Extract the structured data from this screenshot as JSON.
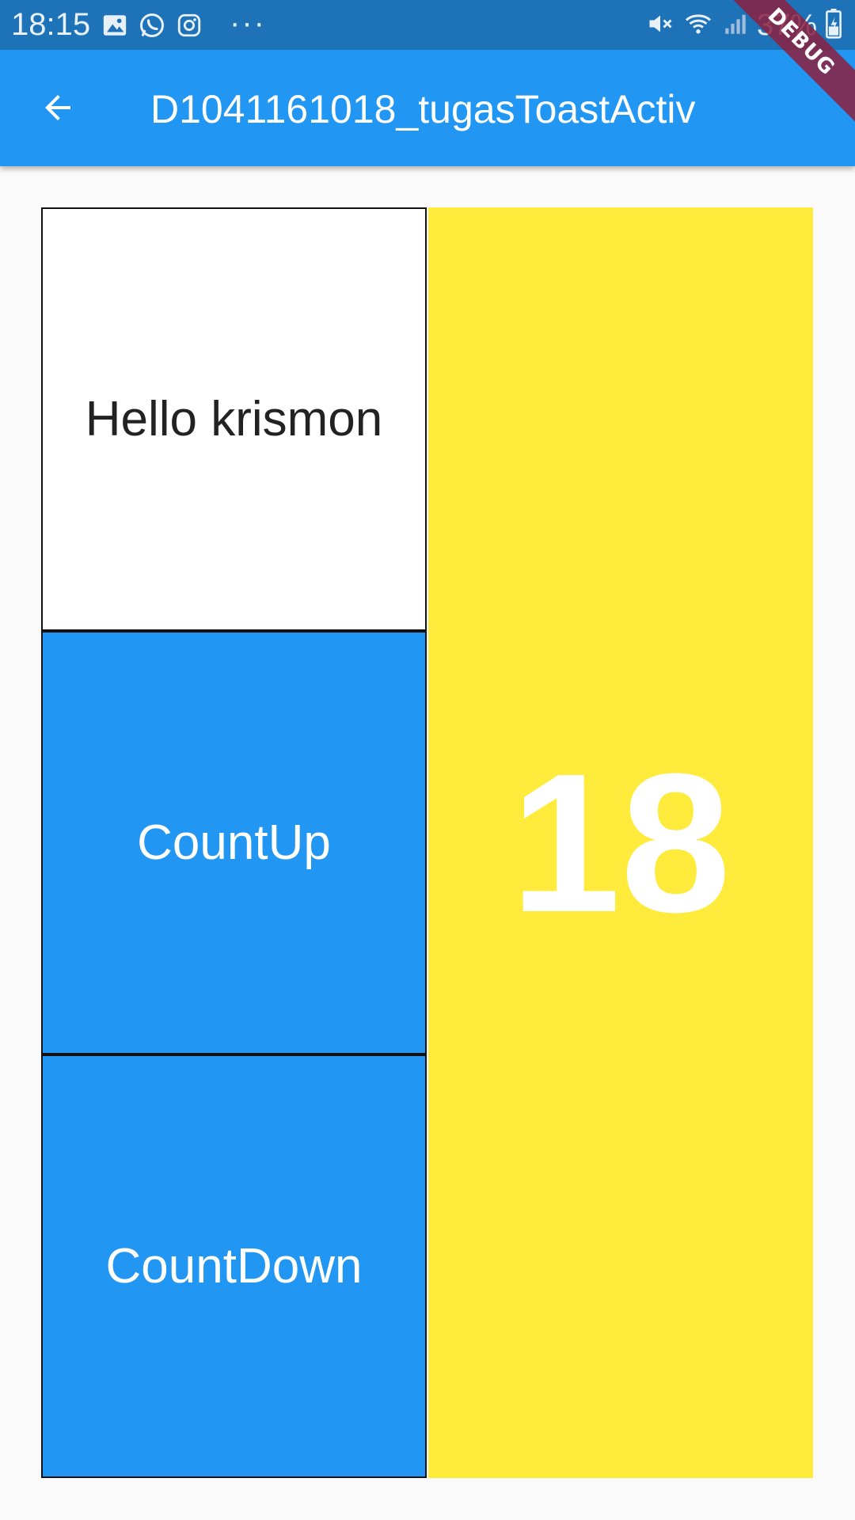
{
  "status_bar": {
    "time": "18:15",
    "battery": "37%",
    "more": "···",
    "icons": [
      "image-icon",
      "whatsapp-icon",
      "instagram-icon",
      "mute-icon",
      "wifi-icon",
      "signal-icon",
      "battery-icon"
    ]
  },
  "app_bar": {
    "title": "D1041161018_tugasToastActiv",
    "back_icon": "arrow-back-icon",
    "debug_banner": "DEBUG"
  },
  "main": {
    "greeting": "Hello krismon",
    "count_up_label": "CountUp",
    "count_down_label": "CountDown",
    "counter_value": "18"
  },
  "colors": {
    "status_bar": "#1e73b8",
    "app_bar": "#2196f3",
    "button_blue": "#2196f3",
    "counter_bg": "#ffeb3b",
    "page_bg": "#fafafa"
  }
}
